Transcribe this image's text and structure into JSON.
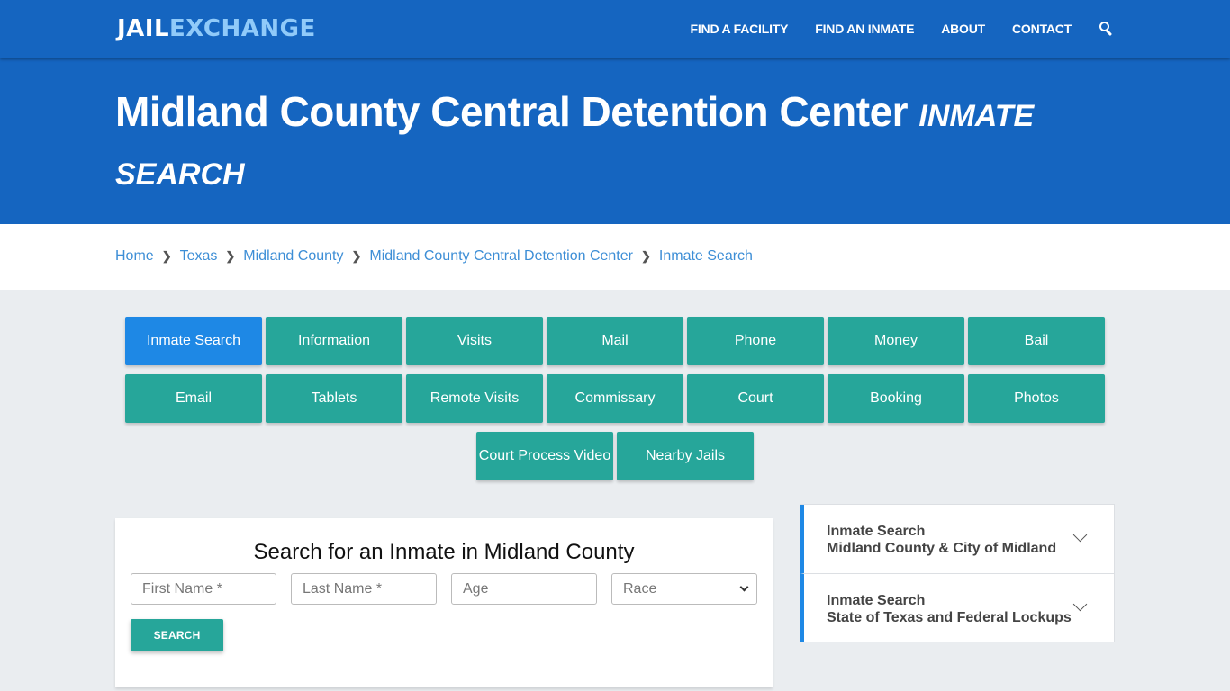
{
  "header": {
    "logo_part1": "JAIL",
    "logo_part2": "EXCHANGE",
    "nav": [
      {
        "label": "FIND A FACILITY"
      },
      {
        "label": "FIND AN INMATE"
      },
      {
        "label": "ABOUT"
      },
      {
        "label": "CONTACT"
      }
    ],
    "search_icon": "search-icon"
  },
  "hero": {
    "title": "Midland County Central Detention Center",
    "subtitle": "INMATE SEARCH"
  },
  "breadcrumb": [
    {
      "label": "Home"
    },
    {
      "label": "Texas"
    },
    {
      "label": "Midland County"
    },
    {
      "label": "Midland County Central Detention Center"
    },
    {
      "label": "Inmate Search"
    }
  ],
  "tabs": {
    "row1": [
      "Inmate Search",
      "Information",
      "Visits",
      "Mail",
      "Phone",
      "Money",
      "Bail"
    ],
    "row2": [
      "Email",
      "Tablets",
      "Remote Visits",
      "Commissary",
      "Court",
      "Booking",
      "Photos"
    ],
    "row3": [
      "Court Process Video",
      "Nearby Jails"
    ],
    "active": "Inmate Search"
  },
  "search_form": {
    "heading": "Search for an Inmate in Midland County",
    "first_name_placeholder": "First Name *",
    "last_name_placeholder": "Last Name *",
    "age_placeholder": "Age",
    "race_selected": "Race",
    "submit_label": "SEARCH"
  },
  "accordion": [
    {
      "line1": "Inmate Search",
      "line2": "Midland County & City of Midland"
    },
    {
      "line1": "Inmate Search",
      "line2": "State of Texas and Federal Lockups"
    }
  ],
  "colors": {
    "brand_blue": "#1565c0",
    "logo_accent": "#90caf9",
    "active_tab": "#1e88e5",
    "teal": "#26a69a",
    "link": "#3d8ed6"
  }
}
